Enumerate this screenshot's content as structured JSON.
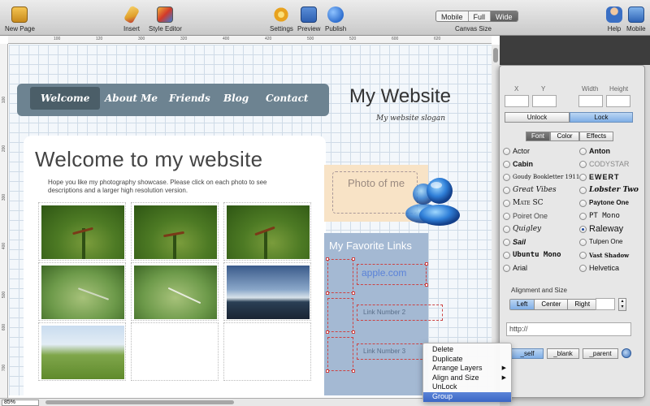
{
  "toolbar": {
    "new_page": "New Page",
    "insert": "Insert",
    "style_editor": "Style Editor",
    "settings": "Settings",
    "preview": "Preview",
    "publish": "Publish",
    "canvas_modes": [
      "Mobile",
      "Full",
      "Wide"
    ],
    "canvas_mode_selected": "Wide",
    "canvas_size_label": "Canvas Size",
    "help": "Help",
    "mobile": "Mobile"
  },
  "rulers": {
    "top_ticks": [
      "100",
      "120",
      "300",
      "320",
      "400",
      "420",
      "500",
      "520",
      "600",
      "620"
    ],
    "left_ticks": [
      "100",
      "200",
      "300",
      "400",
      "500",
      "600",
      "700"
    ]
  },
  "zoom": "85%",
  "website": {
    "nav": [
      "Welcome",
      "About Me",
      "Friends",
      "Blog",
      "Contact"
    ],
    "nav_active": "Welcome",
    "title": "My Website",
    "slogan": "My website slogan",
    "heading": "Welcome to my website",
    "intro": "Hope you like my photography showcase.  Please click on each photo to see descriptions and a larger high resolution version.",
    "photo_of_me": "Photo of me",
    "links_heading": "My Favorite Links",
    "links": [
      "apple.com",
      "Link Number 2",
      "Link Number 3"
    ]
  },
  "context_menu": {
    "items": [
      {
        "label": "Delete",
        "submenu": false
      },
      {
        "label": "Duplicate",
        "submenu": false
      },
      {
        "label": "Arrange Layers",
        "submenu": true
      },
      {
        "label": "Align and Size",
        "submenu": true
      },
      {
        "label": "UnLock",
        "submenu": false
      },
      {
        "label": "Group",
        "submenu": false
      }
    ],
    "selected": "Group"
  },
  "inspector": {
    "x_label": "X",
    "y_label": "Y",
    "width_label": "Width",
    "height_label": "Height",
    "unlock": "Unlock",
    "lock": "Lock",
    "tabs": [
      "Font",
      "Color",
      "Effects"
    ],
    "tab_selected": "Font",
    "fonts_left": [
      "Actor",
      "Cabin",
      "Goudy Bookletter 1911",
      "Great Vibes",
      "Mate SC",
      "Poiret One",
      "Quigley",
      "Sail",
      "Ubuntu Mono",
      "Arial"
    ],
    "fonts_right": [
      "Anton",
      "CODYSTAR",
      "EWERT",
      "Lobster Two",
      "Paytone One",
      "PT Mono",
      "Raleway",
      "Tulpen One",
      "Vast Shadow",
      "Helvetica"
    ],
    "font_selected": "Raleway",
    "alignment_label": "Alignment and Size",
    "align_options": [
      "Left",
      "Center",
      "Right"
    ],
    "align_selected": "Left",
    "url_value": "http://",
    "targets": [
      "_self",
      "_blank",
      "_parent"
    ],
    "target_selected": "_self"
  },
  "colors": {
    "nav_bg": "#6d8391",
    "links_bg": "#a4b9d3",
    "photo_bg": "#f8e3c6",
    "selection": "#3a66c4"
  }
}
